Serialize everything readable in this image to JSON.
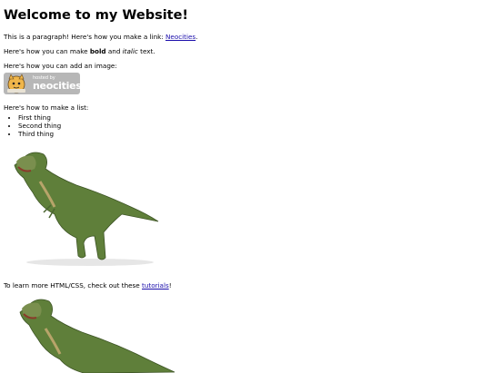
{
  "heading": "Welcome to my Website!",
  "para1": {
    "text": "This is a paragraph! Here's how you make a link: ",
    "link": "Neocities",
    "end": "."
  },
  "para2": {
    "pre": "Here's how you can make ",
    "bold": "bold",
    "mid": " and ",
    "italic": "italic",
    "post": " text."
  },
  "para3": "Here's how you can add an image:",
  "badge": {
    "hosted": "hosted by",
    "name": "neocities"
  },
  "para4": "Here's how to make a list:",
  "list": [
    "First thing",
    "Second thing",
    "Third thing"
  ],
  "para5": {
    "pre": "To learn more HTML/CSS, check out these ",
    "link": "tutorials",
    "post": "!"
  }
}
